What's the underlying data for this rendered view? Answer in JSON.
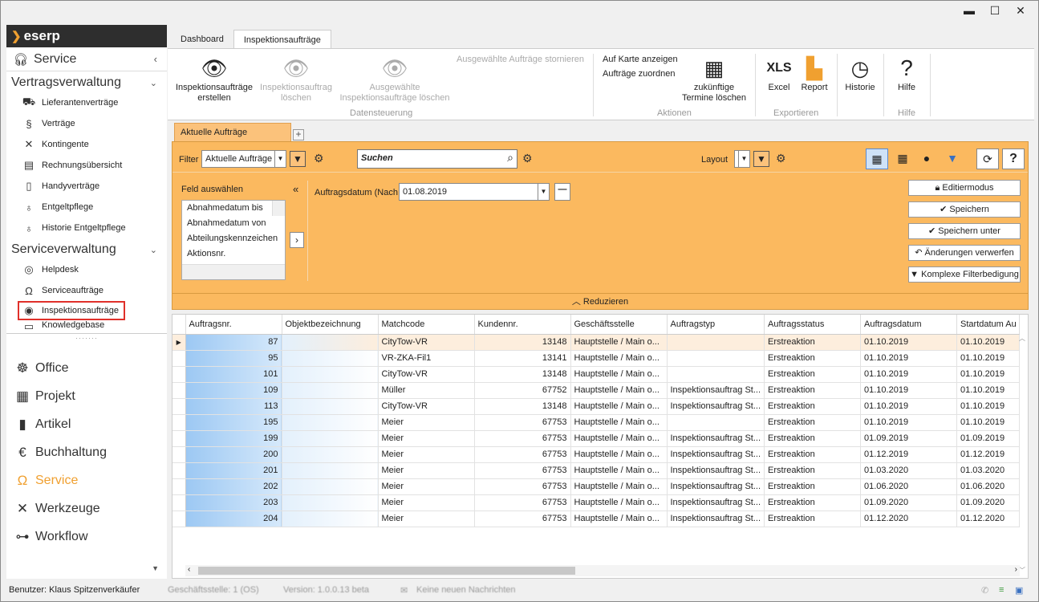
{
  "window": {
    "minimize": "▬",
    "maximize": "☐",
    "close": "✕"
  },
  "nav": {
    "logo": "eserp",
    "section_title": "Service",
    "groups": [
      {
        "title": "Vertragsverwaltung",
        "items": [
          "Lieferantenverträge",
          "Verträge",
          "Kontingente",
          "Rechnungsübersicht",
          "Handyverträge",
          "Entgeltpflege",
          "Historie Entgeltpflege"
        ]
      },
      {
        "title": "Serviceverwaltung",
        "items": [
          "Helpdesk",
          "Serviceaufträge",
          "Inspektionsaufträge",
          "Knowledgebase"
        ]
      }
    ],
    "modules": [
      "Office",
      "Projekt",
      "Artikel",
      "Buchhaltung",
      "Service",
      "Werkzeuge",
      "Workflow"
    ],
    "active_module": "Service",
    "selected_item": "Inspektionsaufträge"
  },
  "tabs": [
    "Dashboard",
    "Inspektionsaufträge"
  ],
  "ribbon": {
    "create": "Inspektionsaufträge erstellen",
    "delete": "Inspektionsauftrag löschen",
    "delete_selected": "Ausgewählte Inspektionsaufträge löschen",
    "cancel_selected": "Ausgewählte Aufträge stornieren",
    "group_data": "Datensteuerung",
    "map": "Auf Karte anzeigen",
    "assign": "Aufträge zuordnen",
    "future_delete": "zukünftige Termine löschen",
    "group_actions": "Aktionen",
    "excel_icon": "XLS",
    "excel": "Excel",
    "report": "Report",
    "group_export": "Exportieren",
    "history": "Historie",
    "help": "Hilfe",
    "group_help": "Hilfe"
  },
  "content_tab": "Aktuelle Aufträge",
  "filter": {
    "label": "Filter",
    "value": "Aktuelle Aufträge",
    "search_placeholder": "Suchen",
    "layout_label": "Layout",
    "field_select": "Feld auswählen",
    "collapse": "«",
    "fields": [
      "Abnahmedatum bis",
      "Abnahmedatum von",
      "Abteilungskennzeichen",
      "Aktionsnr."
    ],
    "condition_label": "Auftragsdatum (Nach",
    "condition_value": "01.08.2019",
    "buttons": [
      "Editiermodus",
      "Speichern",
      "Speichern unter",
      "Änderungen verwerfen",
      "Komplexe Filterbedigung"
    ],
    "reduce": "Reduzieren"
  },
  "grid": {
    "columns": [
      "Auftragsnr.",
      "Objektbezeichnung",
      "Matchcode",
      "Kundennr.",
      "Geschäftsstelle",
      "Auftragstyp",
      "Auftragsstatus",
      "Auftragsdatum",
      "Startdatum Au"
    ],
    "rows": [
      [
        "87",
        "",
        "CityTow-VR",
        "13148",
        "Hauptstelle / Main o...",
        "",
        "Erstreaktion",
        "01.10.2019",
        "01.10.2019"
      ],
      [
        "95",
        "",
        "VR-ZKA-Fil1",
        "13141",
        "Hauptstelle / Main o...",
        "",
        "Erstreaktion",
        "01.10.2019",
        "01.10.2019"
      ],
      [
        "101",
        "",
        "CityTow-VR",
        "13148",
        "Hauptstelle / Main o...",
        "",
        "Erstreaktion",
        "01.10.2019",
        "01.10.2019"
      ],
      [
        "109",
        "",
        "Müller",
        "67752",
        "Hauptstelle / Main o...",
        "Inspektionsauftrag St...",
        "Erstreaktion",
        "01.10.2019",
        "01.10.2019"
      ],
      [
        "113",
        "",
        "CityTow-VR",
        "13148",
        "Hauptstelle / Main o...",
        "Inspektionsauftrag St...",
        "Erstreaktion",
        "01.10.2019",
        "01.10.2019"
      ],
      [
        "195",
        "",
        "Meier",
        "67753",
        "Hauptstelle / Main o...",
        "",
        "Erstreaktion",
        "01.10.2019",
        "01.10.2019"
      ],
      [
        "199",
        "",
        "Meier",
        "67753",
        "Hauptstelle / Main o...",
        "Inspektionsauftrag St...",
        "Erstreaktion",
        "01.09.2019",
        "01.09.2019"
      ],
      [
        "200",
        "",
        "Meier",
        "67753",
        "Hauptstelle / Main o...",
        "Inspektionsauftrag St...",
        "Erstreaktion",
        "01.12.2019",
        "01.12.2019"
      ],
      [
        "201",
        "",
        "Meier",
        "67753",
        "Hauptstelle / Main o...",
        "Inspektionsauftrag St...",
        "Erstreaktion",
        "01.03.2020",
        "01.03.2020"
      ],
      [
        "202",
        "",
        "Meier",
        "67753",
        "Hauptstelle / Main o...",
        "Inspektionsauftrag St...",
        "Erstreaktion",
        "01.06.2020",
        "01.06.2020"
      ],
      [
        "203",
        "",
        "Meier",
        "67753",
        "Hauptstelle / Main o...",
        "Inspektionsauftrag St...",
        "Erstreaktion",
        "01.09.2020",
        "01.09.2020"
      ],
      [
        "204",
        "",
        "Meier",
        "67753",
        "Hauptstelle / Main o...",
        "Inspektionsauftrag St...",
        "Erstreaktion",
        "01.12.2020",
        "01.12.2020"
      ]
    ]
  },
  "status": {
    "user": "Benutzer: Klaus Spitzenverkäufer",
    "branch": "Geschäftsstelle: 1 (OS)",
    "version": "Version: 1.0.0.13 beta",
    "messages": "Keine neuen Nachrichten"
  },
  "colors": {
    "accent": "#f0a030",
    "filter_bg": "#fbb95f",
    "selection_red": "#e0302a"
  }
}
